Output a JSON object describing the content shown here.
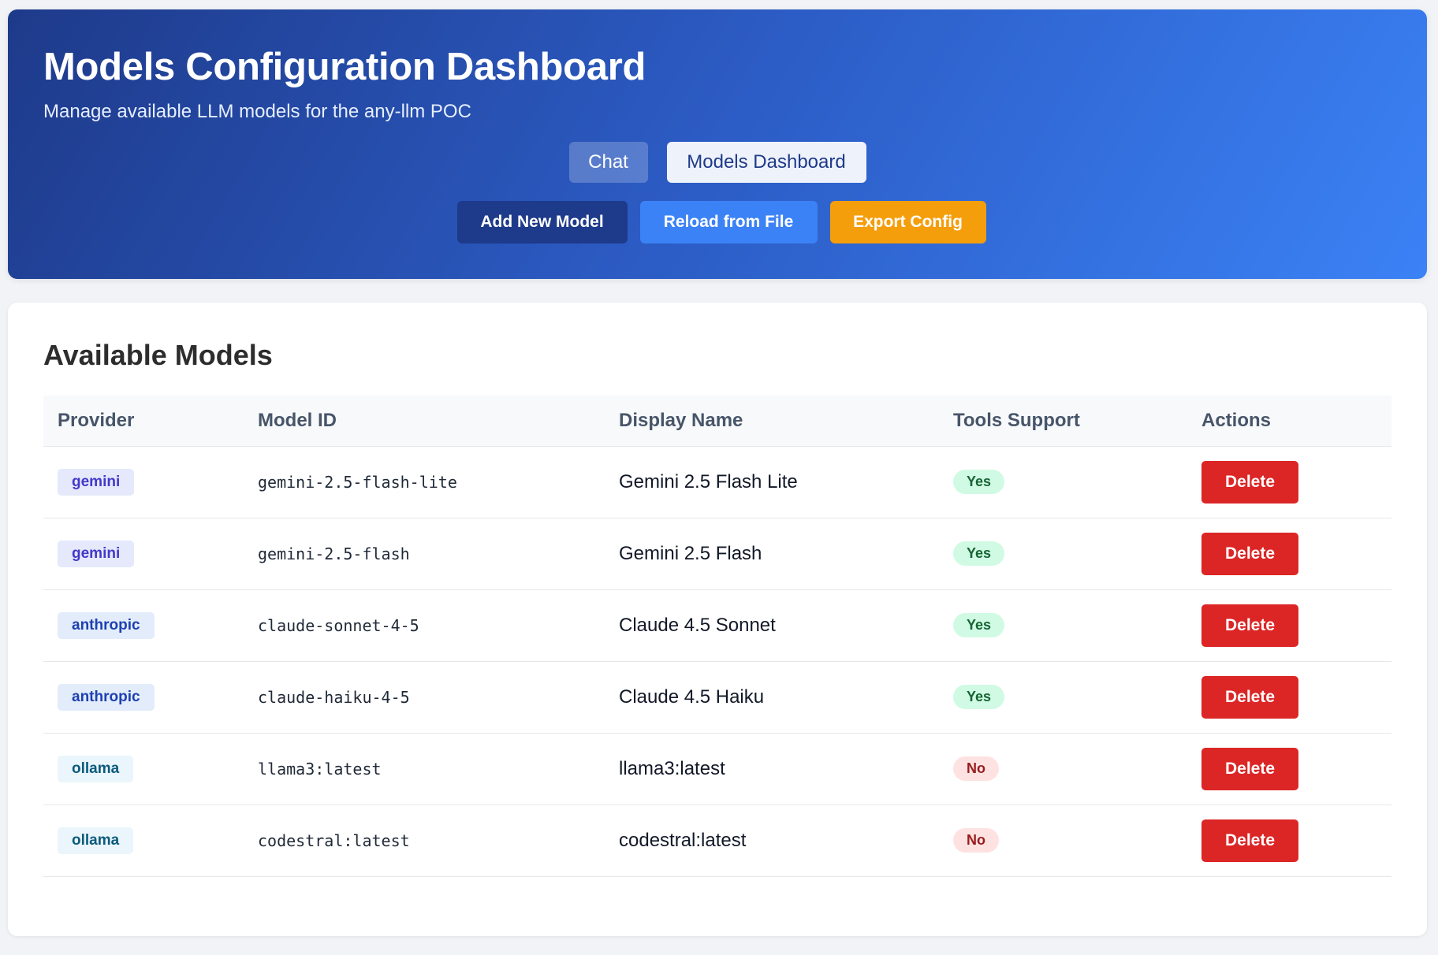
{
  "header": {
    "title": "Models Configuration Dashboard",
    "subtitle": "Manage available LLM models for the any-llm POC",
    "nav": {
      "chat_label": "Chat",
      "dashboard_label": "Models Dashboard"
    },
    "actions": {
      "add_label": "Add New Model",
      "reload_label": "Reload from File",
      "export_label": "Export Config"
    }
  },
  "models": {
    "title": "Available Models",
    "columns": {
      "provider": "Provider",
      "model_id": "Model ID",
      "display_name": "Display Name",
      "tools": "Tools Support",
      "actions": "Actions"
    },
    "delete_label": "Delete",
    "rows": [
      {
        "provider": "gemini",
        "model_id": "gemini-2.5-flash-lite",
        "display_name": "Gemini 2.5 Flash Lite",
        "tools": "Yes"
      },
      {
        "provider": "gemini",
        "model_id": "gemini-2.5-flash",
        "display_name": "Gemini 2.5 Flash",
        "tools": "Yes"
      },
      {
        "provider": "anthropic",
        "model_id": "claude-sonnet-4-5",
        "display_name": "Claude 4.5 Sonnet",
        "tools": "Yes"
      },
      {
        "provider": "anthropic",
        "model_id": "claude-haiku-4-5",
        "display_name": "Claude 4.5 Haiku",
        "tools": "Yes"
      },
      {
        "provider": "ollama",
        "model_id": "llama3:latest",
        "display_name": "llama3:latest",
        "tools": "No"
      },
      {
        "provider": "ollama",
        "model_id": "codestral:latest",
        "display_name": "codestral:latest",
        "tools": "No"
      }
    ]
  },
  "colors": {
    "header_gradient_start": "#1e3a8a",
    "header_gradient_end": "#3b82f6",
    "add_button": "#1e3a8a",
    "reload_button": "#3b82f6",
    "export_button": "#f59e0b",
    "delete_button": "#dc2626",
    "yes_badge": "#d1fae5",
    "no_badge": "#fee2e2"
  }
}
